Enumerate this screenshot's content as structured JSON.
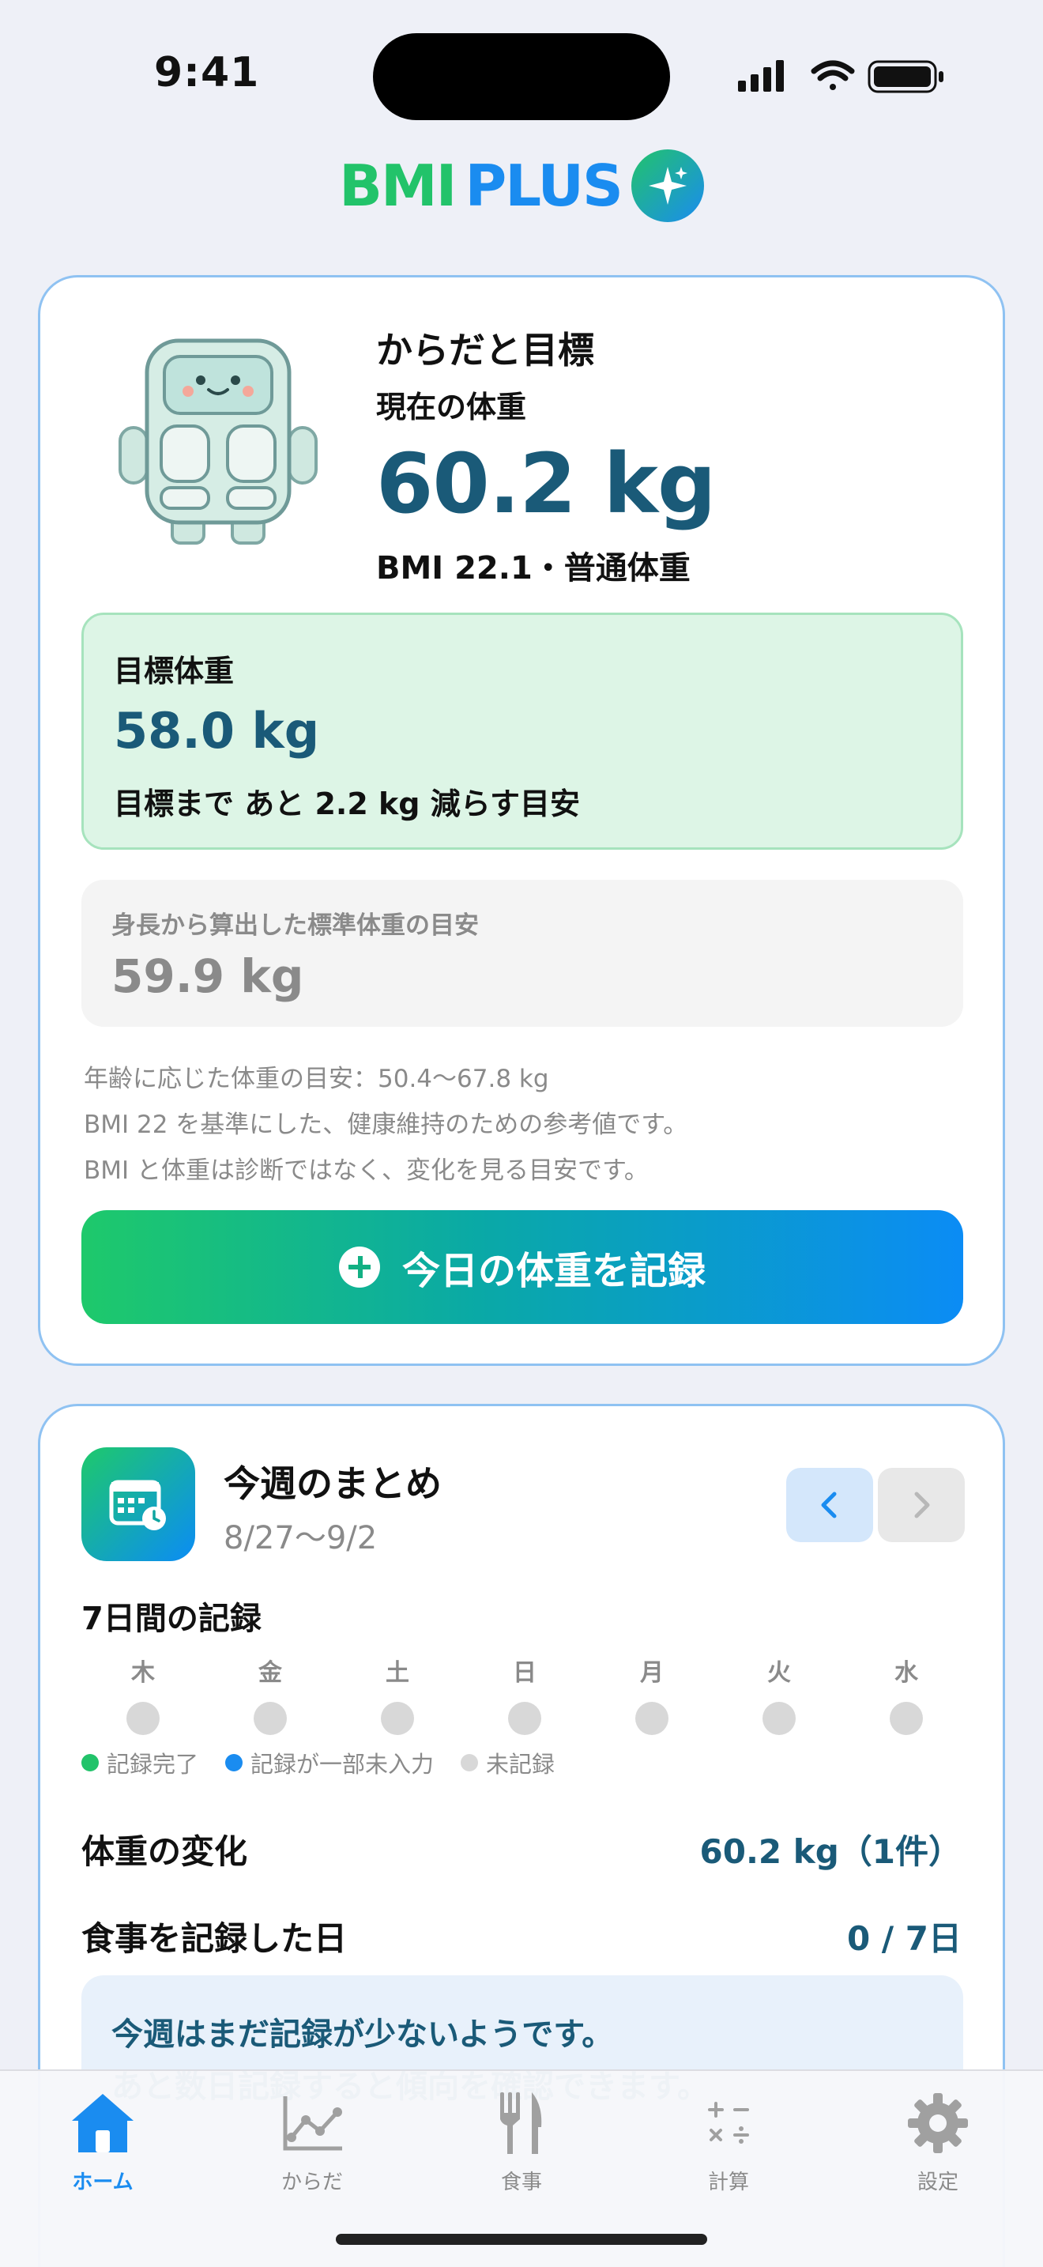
{
  "status_bar": {
    "time": "9:41"
  },
  "app": {
    "logo_part1": "BMI",
    "logo_part2": "PLUS"
  },
  "goal_card": {
    "title": "からだと目標",
    "current_label": "現在の体重",
    "current_weight": "60.2 kg",
    "bmi_line": "BMI 22.1・普通体重",
    "target": {
      "label": "目標体重",
      "value": "58.0 kg",
      "remaining": "目標まで あと 2.2 kg 減らす目安"
    },
    "standard": {
      "label": "身長から算出した標準体重の目安",
      "value": "59.9 kg"
    },
    "notes": [
      "年齢に応じた体重の目安：50.4〜67.8 kg",
      "BMI 22 を基準にした、健康維持のための参考値です。",
      "BMI と体重は診断ではなく、変化を見る目安です。"
    ],
    "record_button": "今日の体重を記録"
  },
  "week_card": {
    "title": "今週のまとめ",
    "range": "8/27〜9/2",
    "days_title": "7日間の記録",
    "days": [
      "木",
      "金",
      "土",
      "日",
      "月",
      "火",
      "水"
    ],
    "legend": [
      {
        "label": "記録完了",
        "color": "#22c36a"
      },
      {
        "label": "記録が一部未入力",
        "color": "#1a8cf0"
      },
      {
        "label": "未記録",
        "color": "#d8d8d8"
      }
    ],
    "weight_change_label": "体重の変化",
    "weight_change_value": "60.2 kg（1件）",
    "meal_days_label": "食事を記録した日",
    "meal_days_value": "0 / 7日",
    "advice_line1": "今週はまだ記録が少ないようです。",
    "advice_line2": "あと数日記録すると傾向を確認できます。"
  },
  "tabbar": {
    "tabs": [
      {
        "label": "ホーム",
        "icon": "home-icon",
        "active": true
      },
      {
        "label": "からだ",
        "icon": "chart-icon",
        "active": false
      },
      {
        "label": "食事",
        "icon": "fork-knife-icon",
        "active": false
      },
      {
        "label": "計算",
        "icon": "calculator-icon",
        "active": false
      },
      {
        "label": "設定",
        "icon": "gear-icon",
        "active": false
      }
    ]
  },
  "colors": {
    "accent_green": "#22c36a",
    "accent_blue": "#1a8cf0",
    "value_teal": "#1a5a78"
  }
}
